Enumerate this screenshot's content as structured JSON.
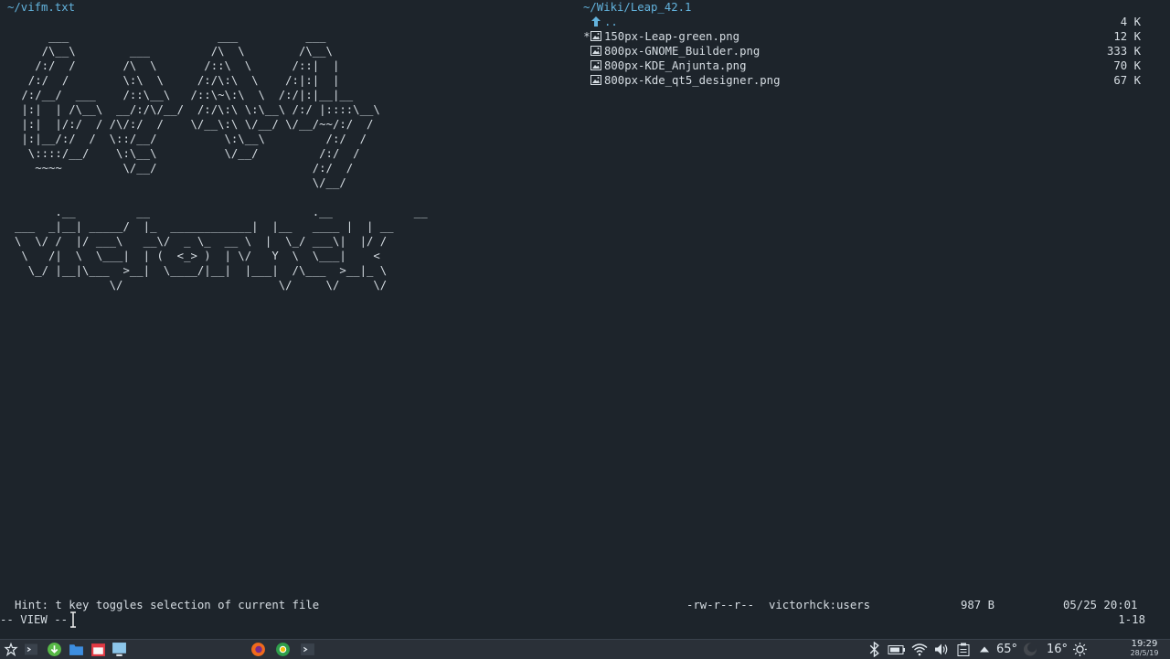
{
  "left_pane": {
    "path": "~/vifm.txt",
    "ascii_art_1": "     ___                      ___          ___\n    /\\__\\        ___         /\\  \\        /\\__\\\n   /:/  /       /\\  \\       /::\\  \\      /::|  |\n  /:/  /        \\:\\  \\     /:/\\:\\  \\    /:|:|  |\n /:/__/  ___    /::\\__\\   /::\\~\\:\\  \\  /:/|:|__|__\n |:|  | /\\__\\  __/:/\\/__/  /:/\\:\\ \\:\\__\\ /:/ |::::\\__\\\n |:|  |/:/  / /\\/:/  /    \\/__\\:\\ \\/__/ \\/__/~~/:/  /\n |:|__/:/  /  \\::/__/          \\:\\__\\         /:/  /\n  \\::::/__/    \\:\\__\\          \\/__/         /:/  /\n   ~~~~         \\/__/                       /:/  /\n                                            \\/__/",
    "ascii_art_2": "      .__         __                        .__            __\n___  _|__| _____/  |_  ____________|  |__   ____ |  | __\n\\  \\/ /  |/ ___\\   __\\/  _ \\_  __ \\  |  \\_/ ___\\|  |/ /\n \\   /|  \\  \\___|  | (  <_> )  | \\/   Y  \\  \\___|    <\n  \\_/ |__|\\___  >__|  \\____/|__|  |___|  /\\___  >__|_ \\\n              \\/                       \\/     \\/     \\/"
  },
  "right_pane": {
    "path": "~/Wiki/Leap_42.1",
    "files": [
      {
        "mark": "",
        "icon": "up-arrow-icon",
        "name": "..",
        "size": "4 K"
      },
      {
        "mark": "*",
        "icon": "image-file-icon",
        "name": "150px-Leap-green.png",
        "size": "12 K"
      },
      {
        "mark": "",
        "icon": "image-file-icon",
        "name": "800px-GNOME_Builder.png",
        "size": "333 K"
      },
      {
        "mark": "",
        "icon": "image-file-icon",
        "name": "800px-KDE_Anjunta.png",
        "size": "70 K"
      },
      {
        "mark": "",
        "icon": "image-file-icon",
        "name": "800px-Kde_qt5_designer.png",
        "size": "67 K"
      }
    ]
  },
  "status_bar": {
    "hint": "Hint: t key toggles selection of current file",
    "permissions": "-rw-r--r--",
    "owner": "victorhck:users",
    "size": "987 B",
    "date": "05/25 20:01"
  },
  "command_line": {
    "mode": "-- VIEW --",
    "position": "1-18"
  },
  "taskbar": {
    "icons": [
      "start-menu-icon",
      "terminal-icon",
      "software-manager-icon",
      "file-manager-icon",
      "calendar-icon",
      "desktop-icon",
      "firefox-icon",
      "chrome-icon",
      "terminal-task-icon"
    ],
    "tray_icons": [
      "bluetooth-icon",
      "battery-icon",
      "wifi-icon",
      "volume-icon",
      "clipboard-icon",
      "expand-tray-icon"
    ],
    "temperature": "65°",
    "weather_temp": "16°",
    "time": "19:29",
    "date": "28/5/19"
  },
  "colors": {
    "background": "#1d242b",
    "path_color": "#63b3dd",
    "text_color": "#d6dde3"
  }
}
